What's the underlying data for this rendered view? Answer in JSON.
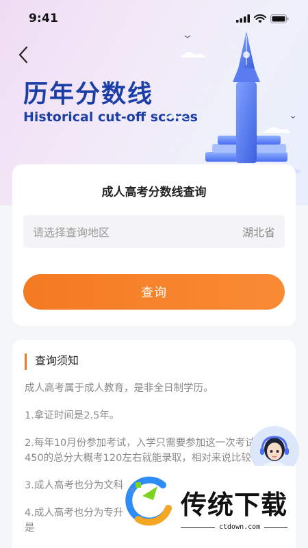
{
  "status_bar": {
    "time": "9:41",
    "icons": [
      "signal-icon",
      "wifi-icon",
      "battery-icon"
    ]
  },
  "header": {
    "back_icon": "chevron-left-icon",
    "title_cn": "历年分数线",
    "title_en": "Historical cut-off scores"
  },
  "query_card": {
    "title": "成人高考分数线查询",
    "region_placeholder": "请选择查询地区",
    "region_value": "湖北省",
    "button_label": "查询"
  },
  "notice": {
    "header": "查询须知",
    "paragraphs": [
      "成人高考属于成人教育，是非全日制学历。",
      "1.拿证时间是2.5年。",
      "2.每年10月份参加考试，入学只需要参加这一次考试，450的总分大概考120左右就能录取，相对来说比较简单。",
      "3.成人高考也分为文科和理科，理科比文科贵几百块钱。",
      "4.成人高考也分为专升本和高起专（高起本）考上的，但也是"
    ]
  },
  "watermark": {
    "brand": "传统下载",
    "url": "ctdown.com"
  },
  "colors": {
    "accent": "#f47a22",
    "title": "#1c3fa6"
  }
}
